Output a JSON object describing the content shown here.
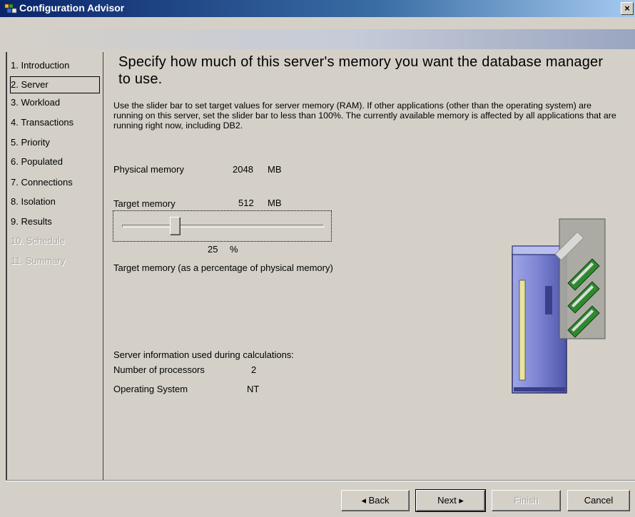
{
  "window": {
    "title": "Configuration Advisor",
    "close_label": "×"
  },
  "nav": {
    "items": [
      {
        "label": "1. Introduction",
        "state": "normal"
      },
      {
        "label": "2. Server",
        "state": "selected"
      },
      {
        "label": "3. Workload",
        "state": "normal"
      },
      {
        "label": "4. Transactions",
        "state": "normal"
      },
      {
        "label": "5. Priority",
        "state": "normal"
      },
      {
        "label": "6. Populated",
        "state": "normal"
      },
      {
        "label": "7. Connections",
        "state": "normal"
      },
      {
        "label": "8. Isolation",
        "state": "normal"
      },
      {
        "label": "9. Results",
        "state": "normal"
      },
      {
        "label": "10. Schedule",
        "state": "disabled"
      },
      {
        "label": "11. Summary",
        "state": "disabled"
      }
    ]
  },
  "main": {
    "heading": "Specify how much of this server's memory you want the database manager to use.",
    "description": "Use the slider bar to set target values for server memory (RAM). If other applications (other than the operating system) are running on this server, set the slider bar to less than 100%. The currently available memory is affected by all applications that are running right now, including DB2.",
    "physical_memory": {
      "label": "Physical memory",
      "value": "2048",
      "unit": "MB"
    },
    "target_memory": {
      "label": "Target memory",
      "value": "512",
      "unit": "MB"
    },
    "slider": {
      "percent": 25,
      "percent_text": "25",
      "percent_unit": "%",
      "caption": "Target memory (as a percentage of physical memory)"
    },
    "server_info": {
      "header": "Server information used during calculations:",
      "processors_label": "Number of processors",
      "processors_value": "2",
      "os_label": "Operating System",
      "os_value": "NT"
    }
  },
  "buttons": {
    "back": "◂ Back",
    "next": "Next ▸",
    "finish": "Finish",
    "cancel": "Cancel"
  },
  "colors": {
    "titlebar_start": "#0a246a",
    "titlebar_end": "#a6caf0",
    "face": "#d4d0c8",
    "disabled_text": "#a9a6a0"
  }
}
